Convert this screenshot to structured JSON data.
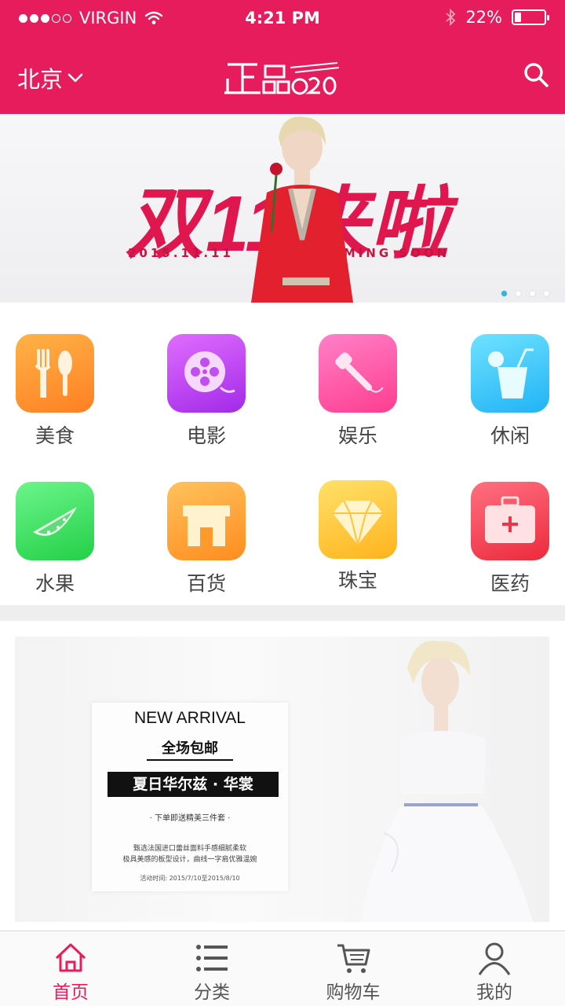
{
  "status_bar": {
    "carrier": "VIRGIN",
    "time": "4:21 PM",
    "battery": "22%",
    "battery_level": 0.22,
    "icons": [
      "signal-dots-icon",
      "wifi-icon",
      "bluetooth-icon",
      "battery-icon"
    ]
  },
  "header": {
    "city": "北京",
    "logo_text": "正品O2O",
    "icons": [
      "chevron-down-icon",
      "search-icon"
    ],
    "accent_color": "#e61c5d"
  },
  "banner": {
    "headline": "双11来啦",
    "date": "2015.11.11",
    "coming": "COMING SOON",
    "pages": 4,
    "active_page": 1
  },
  "categories": [
    {
      "label": "美食",
      "icon": "fork-spoon-icon"
    },
    {
      "label": "电影",
      "icon": "film-reel-icon"
    },
    {
      "label": "娱乐",
      "icon": "microphone-icon"
    },
    {
      "label": "休闲",
      "icon": "drink-icon"
    },
    {
      "label": "水果",
      "icon": "watermelon-icon"
    },
    {
      "label": "百货",
      "icon": "store-icon"
    },
    {
      "label": "珠宝",
      "icon": "diamond-icon"
    },
    {
      "label": "医药",
      "icon": "medical-kit-icon"
    }
  ],
  "promo": {
    "title": "NEW ARRIVAL",
    "free_shipping": "全场包邮",
    "headline": "夏日华尔兹 · 华裳",
    "gift": "· 下单即送精美三件套 ·",
    "desc1": "甄选法国进口蕾丝面料手感细腻柔软",
    "desc2": "极具美感的板型设计，曲线一字肩优雅温婉",
    "date": "活动时间: 2015/7/10至2015/8/10"
  },
  "tabs": [
    {
      "label": "首页",
      "icon": "home-icon",
      "active": true
    },
    {
      "label": "分类",
      "icon": "list-icon",
      "active": false
    },
    {
      "label": "购物车",
      "icon": "cart-icon",
      "active": false
    },
    {
      "label": "我的",
      "icon": "user-icon",
      "active": false
    }
  ]
}
